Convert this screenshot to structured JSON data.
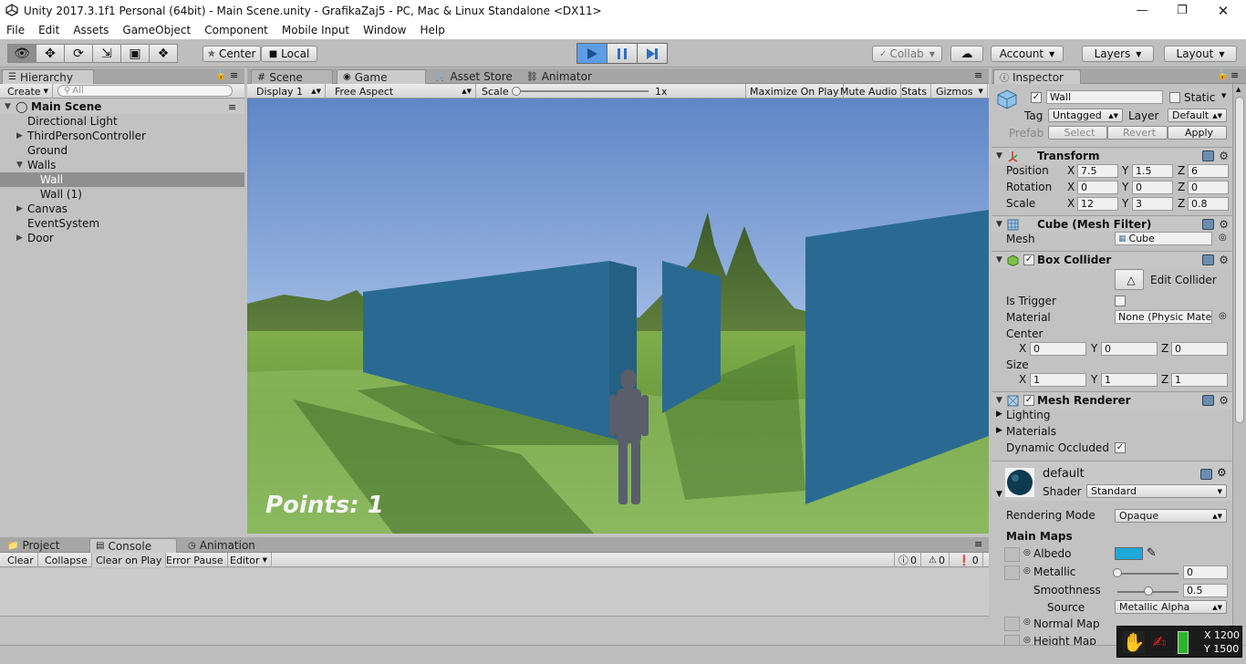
{
  "window": {
    "title": "Unity 2017.3.1f1 Personal (64bit) - Main Scene.unity - GrafikaZaj5 - PC, Mac & Linux Standalone <DX11>"
  },
  "menu": [
    "File",
    "Edit",
    "Assets",
    "GameObject",
    "Component",
    "Mobile Input",
    "Window",
    "Help"
  ],
  "toolbar": {
    "pivot": "Center",
    "space": "Local",
    "collab": "Collab",
    "account": "Account",
    "layers": "Layers",
    "layout": "Layout"
  },
  "hierarchy": {
    "tab": "Hierarchy",
    "create": "Create",
    "search_placeholder": "All",
    "scene": "Main Scene",
    "items": [
      "Directional Light",
      "ThirdPersonController",
      "Ground",
      "Walls",
      "Wall",
      "Wall (1)",
      "Canvas",
      "EventSystem",
      "Door"
    ]
  },
  "center_tabs": {
    "scene": "Scene",
    "game": "Game",
    "asset_store": "Asset Store",
    "animator": "Animator"
  },
  "game_bar": {
    "display": "Display 1",
    "aspect": "Free Aspect",
    "scale_label": "Scale",
    "scale_value": "1x",
    "maximize": "Maximize On Play",
    "mute": "Mute Audio",
    "stats": "Stats",
    "gizmos": "Gizmos"
  },
  "game_view": {
    "points_text": "Points: 1"
  },
  "bottom_tabs": {
    "project": "Project",
    "console": "Console",
    "animation": "Animation"
  },
  "console_bar": {
    "clear": "Clear",
    "collapse": "Collapse",
    "clear_on_play": "Clear on Play",
    "error_pause": "Error Pause",
    "editor": "Editor",
    "info_count": "0",
    "warn_count": "0",
    "error_count": "0"
  },
  "inspector": {
    "tab": "Inspector",
    "object_name": "Wall",
    "static_label": "Static",
    "tag_label": "Tag",
    "tag": "Untagged",
    "layer_label": "Layer",
    "layer": "Default",
    "prefab_label": "Prefab",
    "select": "Select",
    "revert": "Revert",
    "apply": "Apply",
    "transform": {
      "title": "Transform",
      "position_label": "Position",
      "position": [
        "7.5",
        "1.5",
        "6"
      ],
      "rotation_label": "Rotation",
      "rotation": [
        "0",
        "0",
        "0"
      ],
      "scale_label": "Scale",
      "scale": [
        "12",
        "3",
        "0.8"
      ]
    },
    "mesh_filter": {
      "title": "Cube (Mesh Filter)",
      "mesh_label": "Mesh",
      "mesh": "Cube"
    },
    "box_collider": {
      "title": "Box Collider",
      "edit": "Edit Collider",
      "is_trigger": "Is Trigger",
      "material_label": "Material",
      "material": "None (Physic Mate",
      "center_label": "Center",
      "center": [
        "0",
        "0",
        "0"
      ],
      "size_label": "Size",
      "size": [
        "1",
        "1",
        "1"
      ]
    },
    "mesh_renderer": {
      "title": "Mesh Renderer",
      "lighting": "Lighting",
      "materials": "Materials",
      "dynamic": "Dynamic Occluded"
    },
    "material": {
      "name": "default",
      "shader_label": "Shader",
      "shader": "Standard",
      "rendering_mode_label": "Rendering Mode",
      "rendering_mode": "Opaque",
      "main_maps": "Main Maps",
      "albedo": "Albedo",
      "metallic": "Metallic",
      "metallic_value": "0",
      "metallic_level": 0,
      "smoothness": "Smoothness",
      "smoothness_value": "0.5",
      "smoothness_level": 0.5,
      "source": "Source",
      "source_value": "Metallic Alpha",
      "normal_map": "Normal Map",
      "height_map": "Height Map",
      "albedo_color": "#1fa8d8"
    }
  },
  "overlay": {
    "x_label": "X 1200",
    "y_label": "Y 1500"
  }
}
